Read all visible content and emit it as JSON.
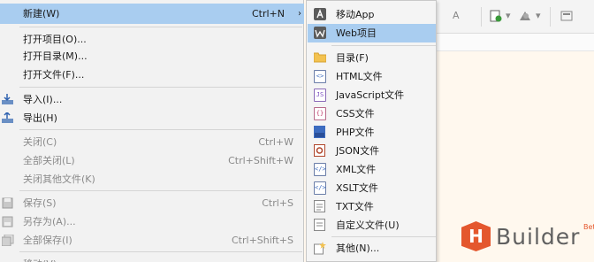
{
  "main_menu": {
    "items": [
      {
        "label": "新建(W)",
        "shortcut": "Ctrl+N",
        "submenu_arrow": "›",
        "highlighted": true,
        "disabled": false
      },
      {
        "label": "打开项目(O)...",
        "shortcut": "",
        "disabled": false
      },
      {
        "label": "打开目录(M)...",
        "shortcut": "",
        "disabled": false
      },
      {
        "label": "打开文件(F)...",
        "shortcut": "",
        "disabled": false
      },
      {
        "label": "导入(I)...",
        "shortcut": "",
        "icon": "import-icon",
        "disabled": false
      },
      {
        "label": "导出(H)",
        "shortcut": "",
        "icon": "export-icon",
        "disabled": false
      },
      {
        "label": "关闭(C)",
        "shortcut": "Ctrl+W",
        "disabled": true
      },
      {
        "label": "全部关闭(L)",
        "shortcut": "Ctrl+Shift+W",
        "disabled": true
      },
      {
        "label": "关闭其他文件(K)",
        "shortcut": "",
        "disabled": true
      },
      {
        "label": "保存(S)",
        "shortcut": "Ctrl+S",
        "icon": "save-icon",
        "disabled": true
      },
      {
        "label": "另存为(A)...",
        "shortcut": "",
        "icon": "save-as-icon",
        "disabled": true
      },
      {
        "label": "全部保存(I)",
        "shortcut": "Ctrl+Shift+S",
        "icon": "save-all-icon",
        "disabled": true
      },
      {
        "label": "移动(V)",
        "shortcut": "",
        "disabled": true
      }
    ]
  },
  "submenu": {
    "items": [
      {
        "label": "移动App",
        "icon": "mobile-app-icon"
      },
      {
        "label": "Web项目",
        "icon": "web-project-icon",
        "highlighted": true
      },
      {
        "label": "目录(F)",
        "icon": "folder-icon"
      },
      {
        "label": "HTML文件",
        "icon": "html-file-icon"
      },
      {
        "label": "JavaScript文件",
        "icon": "js-file-icon"
      },
      {
        "label": "CSS文件",
        "icon": "css-file-icon"
      },
      {
        "label": "PHP文件",
        "icon": "php-file-icon"
      },
      {
        "label": "JSON文件",
        "icon": "json-file-icon"
      },
      {
        "label": "XML文件",
        "icon": "xml-file-icon"
      },
      {
        "label": "XSLT文件",
        "icon": "xslt-file-icon"
      },
      {
        "label": "TXT文件",
        "icon": "txt-file-icon"
      },
      {
        "label": "自定义文件(U)",
        "icon": "custom-file-icon"
      },
      {
        "label": "其他(N)...",
        "icon": "other-icon"
      }
    ]
  },
  "logo": {
    "letter": "H",
    "name": "Builder",
    "badge": "Beta"
  },
  "toolbar": {
    "font_glyph": "A",
    "dropdown_glyph": "▾"
  },
  "colors": {
    "highlight": "#a9cdf0",
    "brand": "#e4572e",
    "editor_bg": "#fff8ee"
  }
}
